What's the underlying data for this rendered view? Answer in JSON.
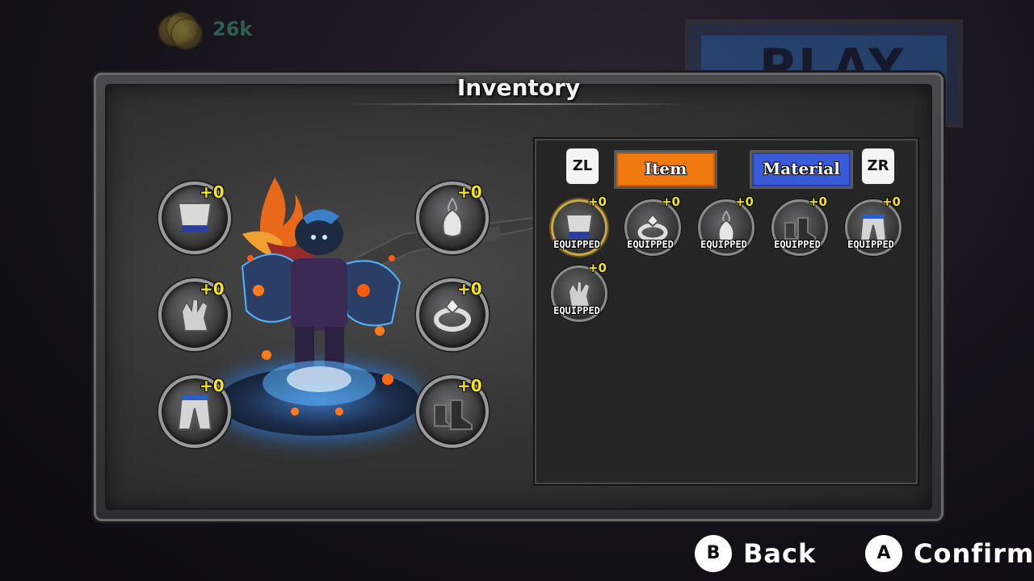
{
  "hud": {
    "coin_count": "26k",
    "play_label": "PLAY"
  },
  "panel": {
    "title": "Inventory"
  },
  "equip_slots": [
    {
      "name": "chest",
      "icon": "chest-armor-icon",
      "level": "+0"
    },
    {
      "name": "necklace",
      "icon": "pendant-icon",
      "level": "+0"
    },
    {
      "name": "gloves",
      "icon": "glove-icon",
      "level": "+0"
    },
    {
      "name": "ring",
      "icon": "ring-icon",
      "level": "+0"
    },
    {
      "name": "pants",
      "icon": "pants-icon",
      "level": "+0"
    },
    {
      "name": "boots",
      "icon": "boots-icon",
      "level": "+0"
    }
  ],
  "tabs": {
    "left_trigger": "ZL",
    "right_trigger": "ZR",
    "item": "Item",
    "material": "Material",
    "active": "Item"
  },
  "inventory_items": [
    {
      "icon": "chest-armor-icon",
      "level": "+0",
      "status": "EQUIPPED",
      "selected": true
    },
    {
      "icon": "ring-icon",
      "level": "+0",
      "status": "EQUIPPED",
      "selected": false
    },
    {
      "icon": "pendant-icon",
      "level": "+0",
      "status": "EQUIPPED",
      "selected": false
    },
    {
      "icon": "boots-icon",
      "level": "+0",
      "status": "EQUIPPED",
      "selected": false
    },
    {
      "icon": "pants-icon",
      "level": "+0",
      "status": "EQUIPPED",
      "selected": false
    },
    {
      "icon": "glove-icon",
      "level": "+0",
      "status": "EQUIPPED",
      "selected": false
    }
  ],
  "prompts": {
    "back_button": "B",
    "back_label": "Back",
    "confirm_button": "A",
    "confirm_label": "Confirm"
  },
  "colors": {
    "level_yellow": "#f5e514",
    "item_tab": "#f07a10",
    "material_tab": "#3a5bd8"
  }
}
